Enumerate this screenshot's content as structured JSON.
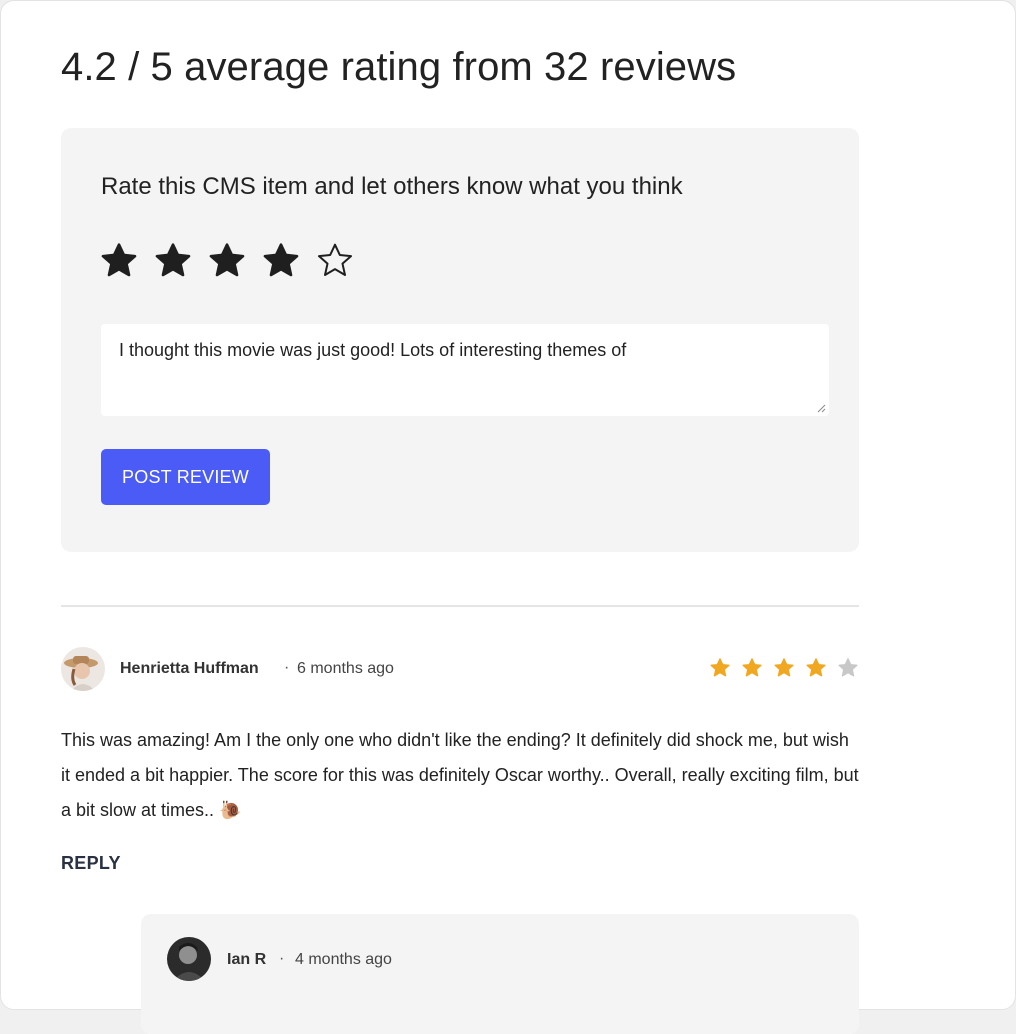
{
  "summary": {
    "headline": "4.2 / 5 average rating from 32 reviews"
  },
  "rate_form": {
    "prompt": "Rate this CMS item and let others know what you think",
    "selected_rating": 4,
    "max_rating": 5,
    "review_text": "I thought this movie was just good! Lots of interesting themes of",
    "post_button_label": "POST REVIEW",
    "star_icon": "star-icon",
    "star_color": "#1f1f1f"
  },
  "reviews": [
    {
      "author": "Henrietta Huffman",
      "separator": "·",
      "time": "6 months ago",
      "rating": 4,
      "max_rating": 5,
      "body": "This was amazing! Am I the only one who didn't like the ending? It definitely did shock me, but wish it ended a bit happier. The score for this was definitely Oscar worthy.. Overall, really exciting film, but a bit slow at times..",
      "emoji": "🐌",
      "reply_label": "REPLY",
      "star_color_on": "#f0a822",
      "star_color_off": "#c8c8c8",
      "replies": [
        {
          "author": "Ian R",
          "separator": "·",
          "time": "4 months ago"
        }
      ]
    }
  ],
  "colors": {
    "accent": "#4a5cf5",
    "card_background": "#f4f4f4",
    "reply_text": "#2a3140"
  }
}
